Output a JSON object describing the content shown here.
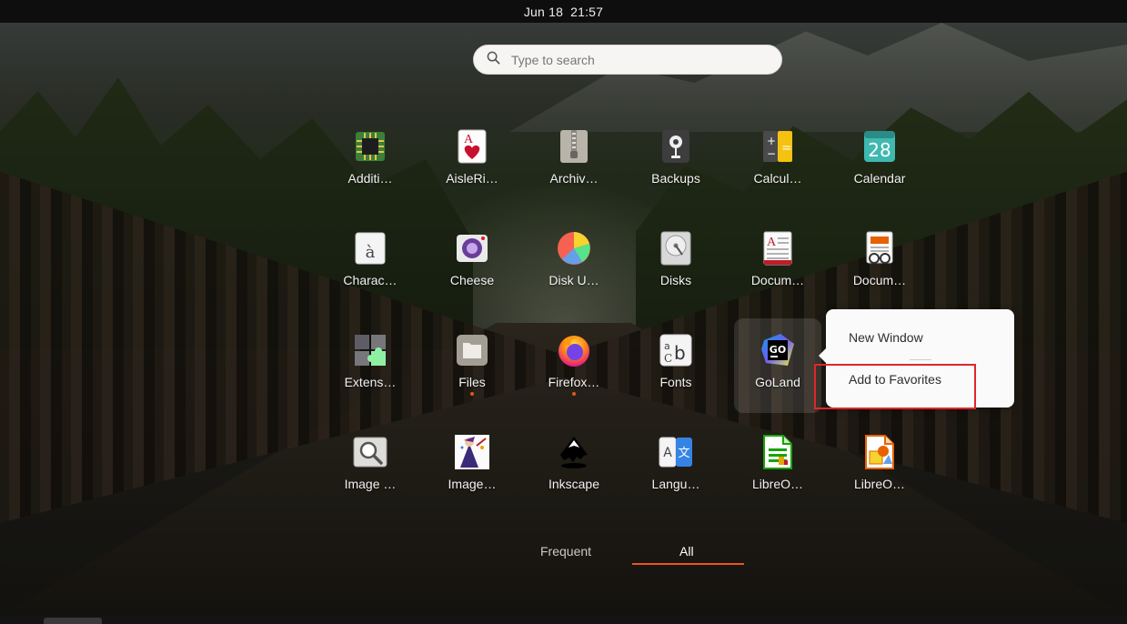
{
  "topbar": {
    "date": "Jun 18",
    "time": "21:57"
  },
  "search": {
    "placeholder": "Type to search"
  },
  "apps": [
    {
      "label": "Additi…",
      "icon": "chip-icon"
    },
    {
      "label": "AisleRi…",
      "icon": "playing-card-icon"
    },
    {
      "label": "Archiv…",
      "icon": "archive-zipper-icon"
    },
    {
      "label": "Backups",
      "icon": "backup-safe-icon"
    },
    {
      "label": "Calcul…",
      "icon": "calculator-icon"
    },
    {
      "label": "Calendar",
      "icon": "calendar-icon",
      "day": "28"
    },
    {
      "label": "Charac…",
      "icon": "character-map-icon",
      "glyph": "à"
    },
    {
      "label": "Cheese",
      "icon": "webcam-icon"
    },
    {
      "label": "Disk U…",
      "icon": "pie-chart-icon"
    },
    {
      "label": "Disks",
      "icon": "disk-icon"
    },
    {
      "label": "Docum…",
      "icon": "document-viewer-icon"
    },
    {
      "label": "Docum…",
      "icon": "document-scanner-icon"
    },
    {
      "label": "Extens…",
      "icon": "puzzle-icon"
    },
    {
      "label": "Files",
      "icon": "folder-icon",
      "running": true
    },
    {
      "label": "Firefox…",
      "icon": "firefox-icon",
      "running": true
    },
    {
      "label": "Fonts",
      "icon": "fonts-icon"
    },
    {
      "label": "GoLand",
      "icon": "goland-icon",
      "badge": "GO",
      "selected": true
    },
    {
      "label": "Image …",
      "icon": "image-viewer-icon"
    },
    {
      "label": "Image…",
      "icon": "image-magick-icon"
    },
    {
      "label": "Inkscape",
      "icon": "inkscape-icon"
    },
    {
      "label": "Langu…",
      "icon": "language-icon",
      "glyphs": [
        "A",
        "文"
      ]
    },
    {
      "label": "LibreO…",
      "icon": "libreoffice-calc-icon"
    },
    {
      "label": "LibreO…",
      "icon": "libreoffice-draw-icon"
    }
  ],
  "context_menu": {
    "items": [
      "New Window",
      "Add to Favorites"
    ]
  },
  "tabs": {
    "frequent": "Frequent",
    "all": "All",
    "active": "All"
  },
  "colors": {
    "accent": "#e95420",
    "highlight": "#e0262a"
  }
}
